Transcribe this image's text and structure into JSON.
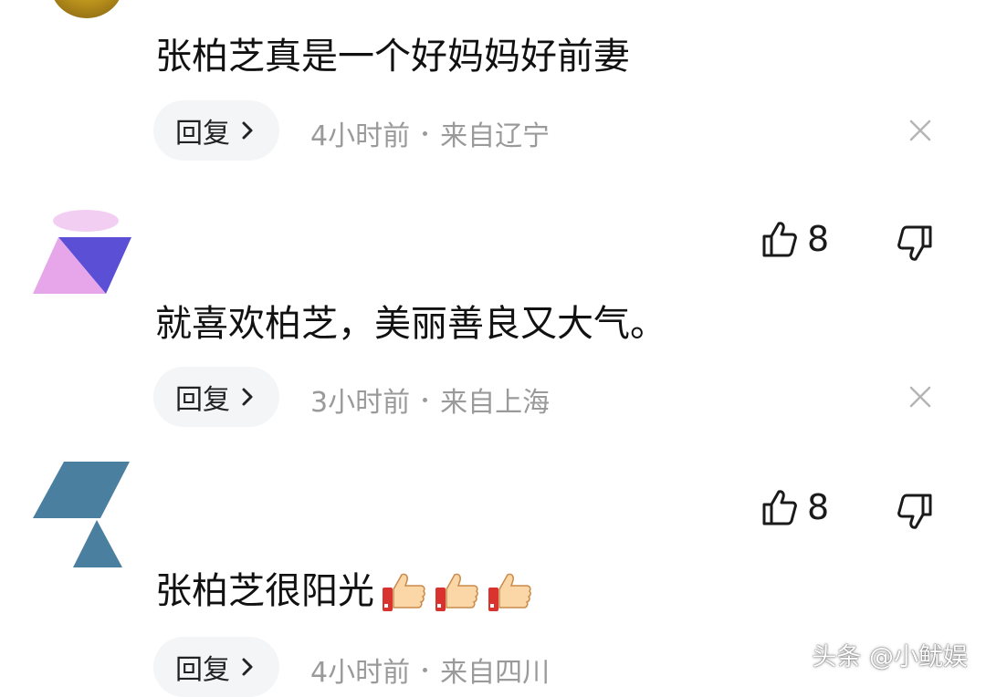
{
  "comments": [
    {
      "text": "张柏芝真是一个好妈妈好前妻",
      "reply_label": "回复",
      "time": "4小时前",
      "location": "来自辽宁"
    },
    {
      "likes": "8",
      "text": "就喜欢柏芝，美丽善良又大气。",
      "reply_label": "回复",
      "time": "3小时前",
      "location": "来自上海"
    },
    {
      "likes": "8",
      "text": "张柏芝很阳光",
      "emoji": [
        "thumbs-up",
        "thumbs-up",
        "thumbs-up"
      ],
      "reply_label": "回复",
      "time": "4小时前",
      "location": "来自四川"
    }
  ],
  "watermark": "头条 @小鱿娱",
  "colors": {
    "meta_gray": "#9a9a9a",
    "reply_bg": "#f4f5f6",
    "avatar2_purple": "#5b4fd6",
    "avatar2_pink": "#e7a6ea",
    "avatar3_teal": "#4a7f9f"
  }
}
